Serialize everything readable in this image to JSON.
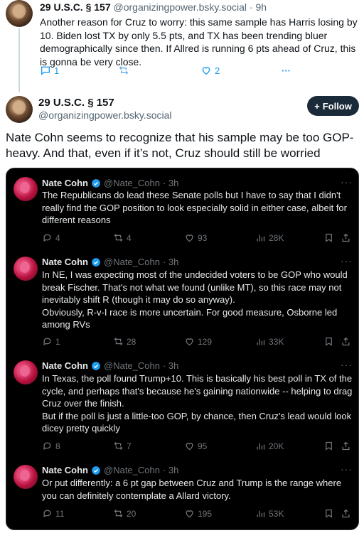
{
  "top_post": {
    "author_name": "29 U.S.C. § 157",
    "handle": "@organizingpower.bsky.social",
    "time": "· 9h",
    "text": "Another reason for Cruz to worry: this same sample has Harris losing by 10. Biden lost TX by only 5.5 pts, and TX has been trending bluer demographically since then. If Allred is running 6 pts ahead of Cruz, this is gonna be very close.",
    "reply_count": "1",
    "like_count": "2",
    "more": "···"
  },
  "main_post": {
    "author_name": "29 U.S.C. § 157",
    "handle": "@organizingpower.bsky.social",
    "follow_label": "Follow",
    "text": "Nate Cohn seems to recognize that his sample may be too GOP-heavy. And that, even if it’s not, Cruz should still be worried"
  },
  "embedded_tweets": [
    {
      "name": "Nate Cohn",
      "handle": "@Nate_Cohn",
      "time": "· 3h",
      "more": "···",
      "text": "The Republicans do lead these Senate polls but I have to say that I didn't really find the GOP position to look especially solid in either case, albeit for different reasons",
      "replies": "4",
      "reposts": "4",
      "likes": "93",
      "views": "28K"
    },
    {
      "name": "Nate Cohn",
      "handle": "@Nate_Cohn",
      "time": "· 3h",
      "more": "···",
      "text": "In NE, I was expecting most of the undecided voters to be GOP who would break Fischer. That's not what we found (unlike MT), so this race may not inevitably shift R (though it may do so anyway).\nObviously, R-v-I race is more uncertain. For good measure, Osborne led among RVs",
      "replies": "1",
      "reposts": "28",
      "likes": "129",
      "views": "33K"
    },
    {
      "name": "Nate Cohn",
      "handle": "@Nate_Cohn",
      "time": "· 3h",
      "more": "···",
      "text": "In Texas, the poll found Trump+10. This is basically his best poll in TX of the cycle, and perhaps that's because he's gaining nationwide -- helping to drag Cruz over the finish.\nBut if the poll is just a little-too GOP, by chance, then Cruz's lead would look dicey pretty quickly",
      "replies": "8",
      "reposts": "7",
      "likes": "95",
      "views": "20K"
    },
    {
      "name": "Nate Cohn",
      "handle": "@Nate_Cohn",
      "time": "· 3h",
      "more": "···",
      "text": "Or put differently: a 6 pt gap between Cruz and Trump is the range where you can definitely contemplate a Allard victory.",
      "replies": "11",
      "reposts": "20",
      "likes": "195",
      "views": "53K"
    }
  ],
  "colors": {
    "bluesky_accent": "#1d9bf0",
    "follow_button_bg": "#1a2a38",
    "embed_bg": "#000000",
    "verified_badge": "#1d9bf0"
  }
}
